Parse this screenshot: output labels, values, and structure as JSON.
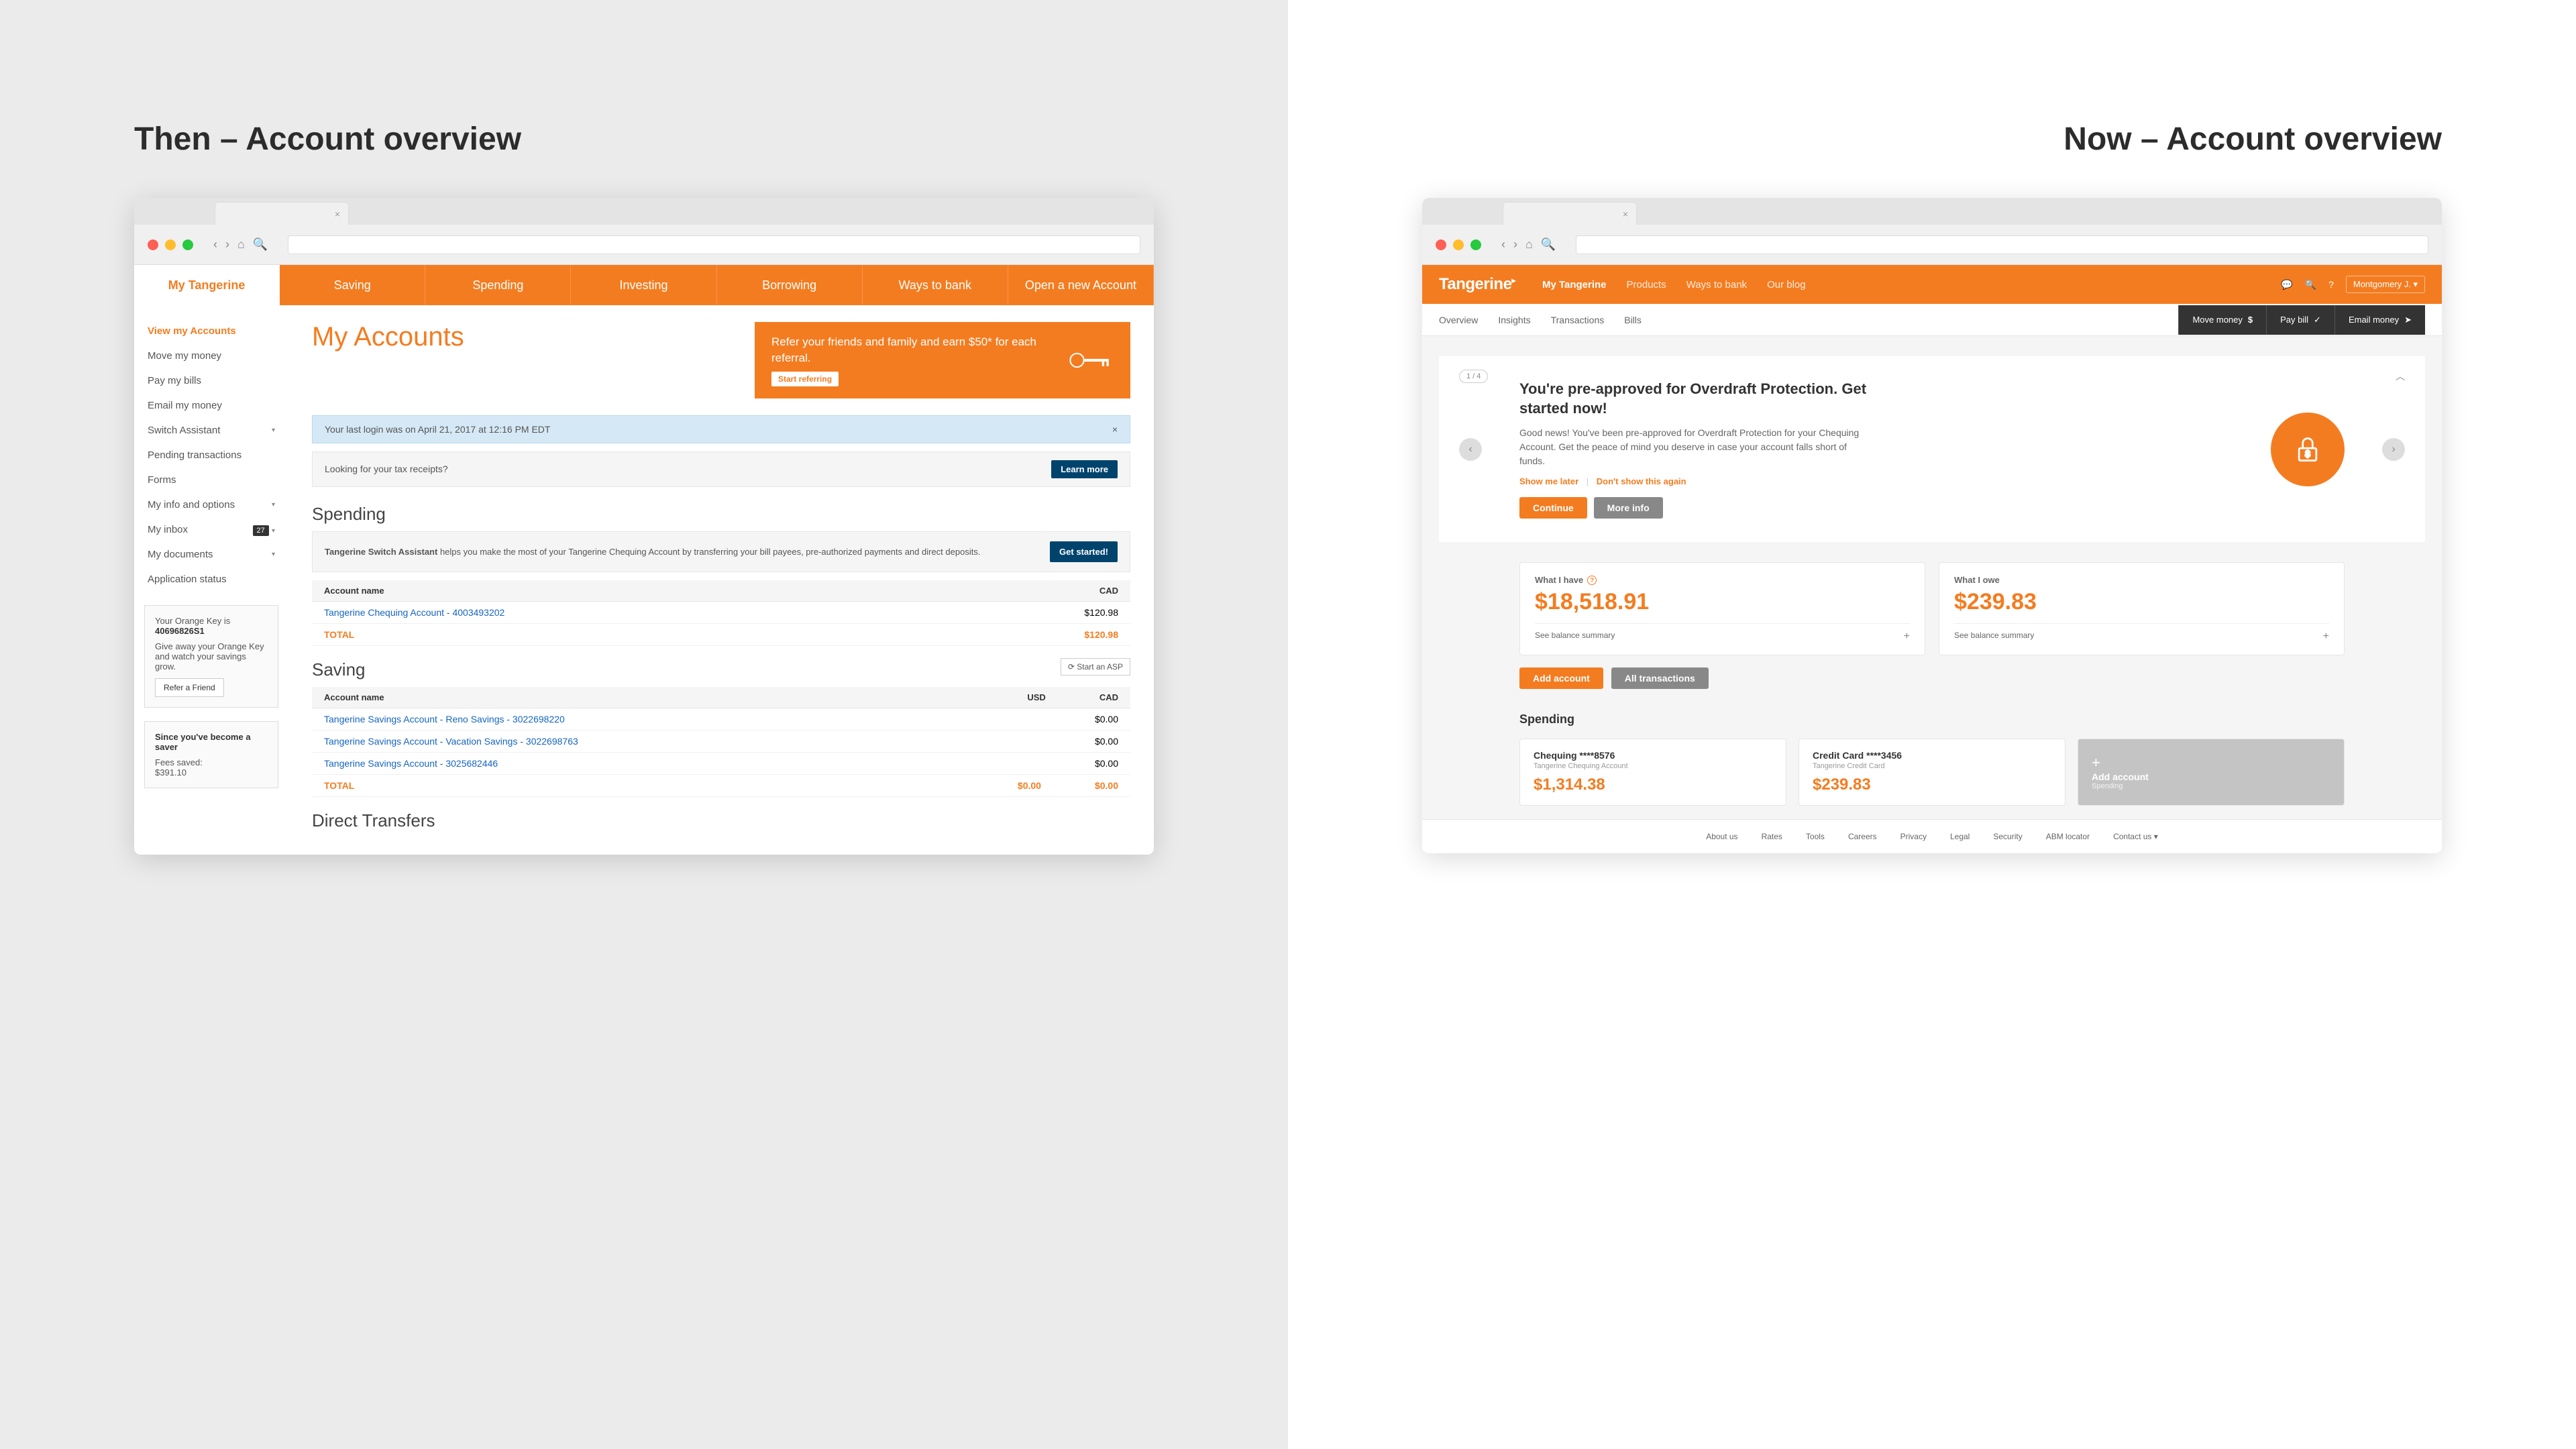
{
  "sections": {
    "then": "Then – Account overview",
    "now": "Now – Account overview"
  },
  "old": {
    "nav": [
      "My Tangerine",
      "Saving",
      "Spending",
      "Investing",
      "Borrowing",
      "Ways to bank",
      "Open a new Account"
    ],
    "sidebar": {
      "links": [
        {
          "label": "View my Accounts",
          "active": true
        },
        {
          "label": "Move my money"
        },
        {
          "label": "Pay my bills"
        },
        {
          "label": "Email my money"
        },
        {
          "label": "Switch Assistant",
          "caret": true
        },
        {
          "label": "Pending transactions"
        },
        {
          "label": "Forms"
        },
        {
          "label": "My info and options",
          "caret": true
        },
        {
          "label": "My inbox",
          "badge": "27",
          "caret": true
        },
        {
          "label": "My documents",
          "caret": true
        },
        {
          "label": "Application status"
        }
      ],
      "orange_key": {
        "title": "Your Orange Key is",
        "key": "40696826S1",
        "desc": "Give away your Orange Key and watch your savings grow.",
        "btn": "Refer a Friend"
      },
      "saver": {
        "title": "Since you've become a saver",
        "label": "Fees saved:",
        "amount": "$391.10"
      }
    },
    "main": {
      "h1": "My Accounts",
      "promo": {
        "text": "Refer your friends and family and earn $50* for each referral.",
        "btn": "Start referring"
      },
      "alert": "Your last login was on April 21, 2017 at 12:16 PM EDT",
      "alert_close": "×",
      "tax_q": "Looking for your tax receipts?",
      "tax_btn": "Learn more",
      "spending": {
        "h": "Spending",
        "switch_label": "Tangerine Switch Assistant",
        "switch_text": " helps you make the most of your Tangerine Chequing Account by transferring your bill payees, pre-authorized payments and direct deposits.",
        "switch_btn": "Get started!",
        "cols": {
          "name": "Account name",
          "cad": "CAD"
        },
        "rows": [
          {
            "name": "Tangerine Chequing Account - 4003493202",
            "cad": "$120.98"
          }
        ],
        "total_label": "TOTAL",
        "total_cad": "$120.98"
      },
      "saving": {
        "h": "Saving",
        "asp_btn": "⟳ Start an ASP",
        "cols": {
          "name": "Account name",
          "usd": "USD",
          "cad": "CAD"
        },
        "rows": [
          {
            "name": "Tangerine Savings Account - Reno Savings - 3022698220",
            "usd": "",
            "cad": "$0.00"
          },
          {
            "name": "Tangerine Savings Account - Vacation Savings - 3022698763",
            "usd": "",
            "cad": "$0.00"
          },
          {
            "name": "Tangerine Savings Account - 3025682446",
            "usd": "",
            "cad": "$0.00"
          }
        ],
        "total_label": "TOTAL",
        "total_usd": "$0.00",
        "total_cad": "$0.00"
      },
      "direct_h": "Direct Transfers"
    }
  },
  "new": {
    "logo": "Tangerine",
    "nav": [
      "My Tangerine",
      "Products",
      "Ways to bank",
      "Our blog"
    ],
    "user": "Montgomery J.",
    "subnav": [
      "Overview",
      "Insights",
      "Transactions",
      "Bills"
    ],
    "actions": {
      "move": "Move money",
      "pay": "Pay bill",
      "email": "Email money"
    },
    "promo": {
      "pager": "1 / 4",
      "h": "You're pre-approved for Overdraft Protection. Get started now!",
      "p": "Good news! You've been pre-approved for Overdraft Protection for your Chequing Account. Get the peace of mind you deserve in case your account falls short of funds.",
      "later": "Show me later",
      "dont": "Don't show this again",
      "continue": "Continue",
      "more": "More info"
    },
    "summary": {
      "have_label": "What I have",
      "have_amount": "$18,518.91",
      "owe_label": "What I owe",
      "owe_amount": "$239.83",
      "link": "See balance summary"
    },
    "buttons": {
      "add": "Add account",
      "all": "All transactions"
    },
    "spending": {
      "h": "Spending",
      "cards": [
        {
          "name": "Chequing ****8576",
          "sub": "Tangerine Chequing Account",
          "amount": "$1,314.38"
        },
        {
          "name": "Credit Card ****3456",
          "sub": "Tangerine Credit Card",
          "amount": "$239.83"
        }
      ],
      "add_label": "Add account",
      "add_sub": "Spending"
    },
    "footer": [
      "About us",
      "Rates",
      "Tools",
      "Careers",
      "Privacy",
      "Legal",
      "Security",
      "ABM locator",
      "Contact us ▾"
    ]
  }
}
